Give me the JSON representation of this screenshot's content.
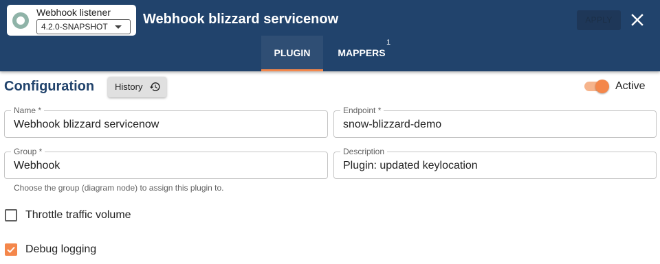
{
  "header": {
    "plugin_name": "Webhook listener",
    "version": "4.2.0-SNAPSHOT",
    "title": "Webhook blizzard servicenow",
    "apply_label": "APPLY",
    "close_icon": "close-icon",
    "background": "#21436c"
  },
  "tabs": [
    {
      "label": "PLUGIN",
      "active": true
    },
    {
      "label": "MAPPERS",
      "badge": "1",
      "active": false
    }
  ],
  "config": {
    "title": "Configuration",
    "history_label": "History",
    "history_icon": "history-icon",
    "active_label": "Active",
    "active": true,
    "accent": "#f4874b"
  },
  "fields": {
    "name": {
      "label": "Name *",
      "value": "Webhook blizzard servicenow"
    },
    "endpoint": {
      "label": "Endpoint *",
      "value": "snow-blizzard-demo"
    },
    "group": {
      "label": "Group *",
      "value": "Webhook",
      "helper": "Choose the group (diagram node) to assign this plugin to."
    },
    "description": {
      "label": "Description",
      "value": "Plugin: updated keylocation"
    }
  },
  "options": {
    "throttle": {
      "label": "Throttle traffic volume",
      "checked": false
    },
    "debug": {
      "label": "Debug logging",
      "checked": true
    }
  }
}
